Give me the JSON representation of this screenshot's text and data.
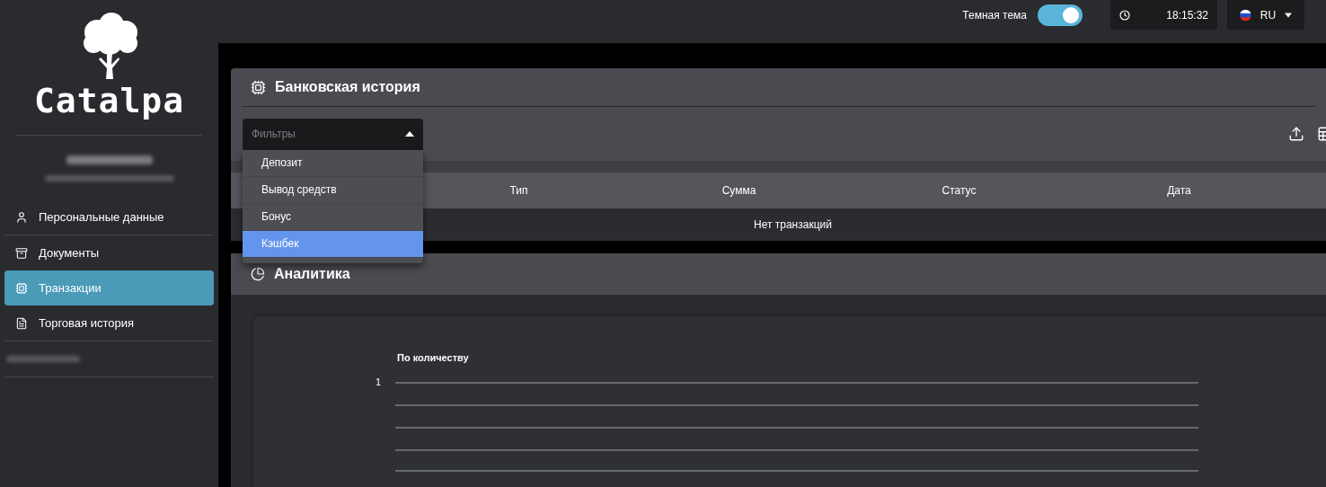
{
  "top_bar": {
    "theme_toggle": {
      "label": "Темная тема",
      "on": true
    },
    "clock": {
      "time": "18:15:32"
    },
    "language": {
      "code": "RU"
    }
  },
  "sidebar": {
    "logo_text": "Catalpa",
    "items": [
      {
        "label": "Персональные данные",
        "selected": false
      },
      {
        "label": "Документы",
        "selected": false
      },
      {
        "label": "Транзакции",
        "selected": true
      },
      {
        "label": "Торговая история",
        "selected": false
      }
    ]
  },
  "bank_history": {
    "title": "Банковская история",
    "filter": {
      "placeholder": "Фильтры",
      "expanded": true,
      "options": [
        {
          "label": "Депозит",
          "selected": false
        },
        {
          "label": "Вывод средств",
          "selected": false
        },
        {
          "label": "Бонус",
          "selected": false
        },
        {
          "label": "Кэшбек",
          "selected": true
        }
      ]
    },
    "table": {
      "columns": [
        "Тип",
        "Сумма",
        "Статус",
        "Дата"
      ],
      "empty_message": "Нет транзакций"
    }
  },
  "analytics": {
    "title": "Аналитика",
    "chart": {
      "title": "По количеству",
      "tick_label": "1"
    }
  }
}
